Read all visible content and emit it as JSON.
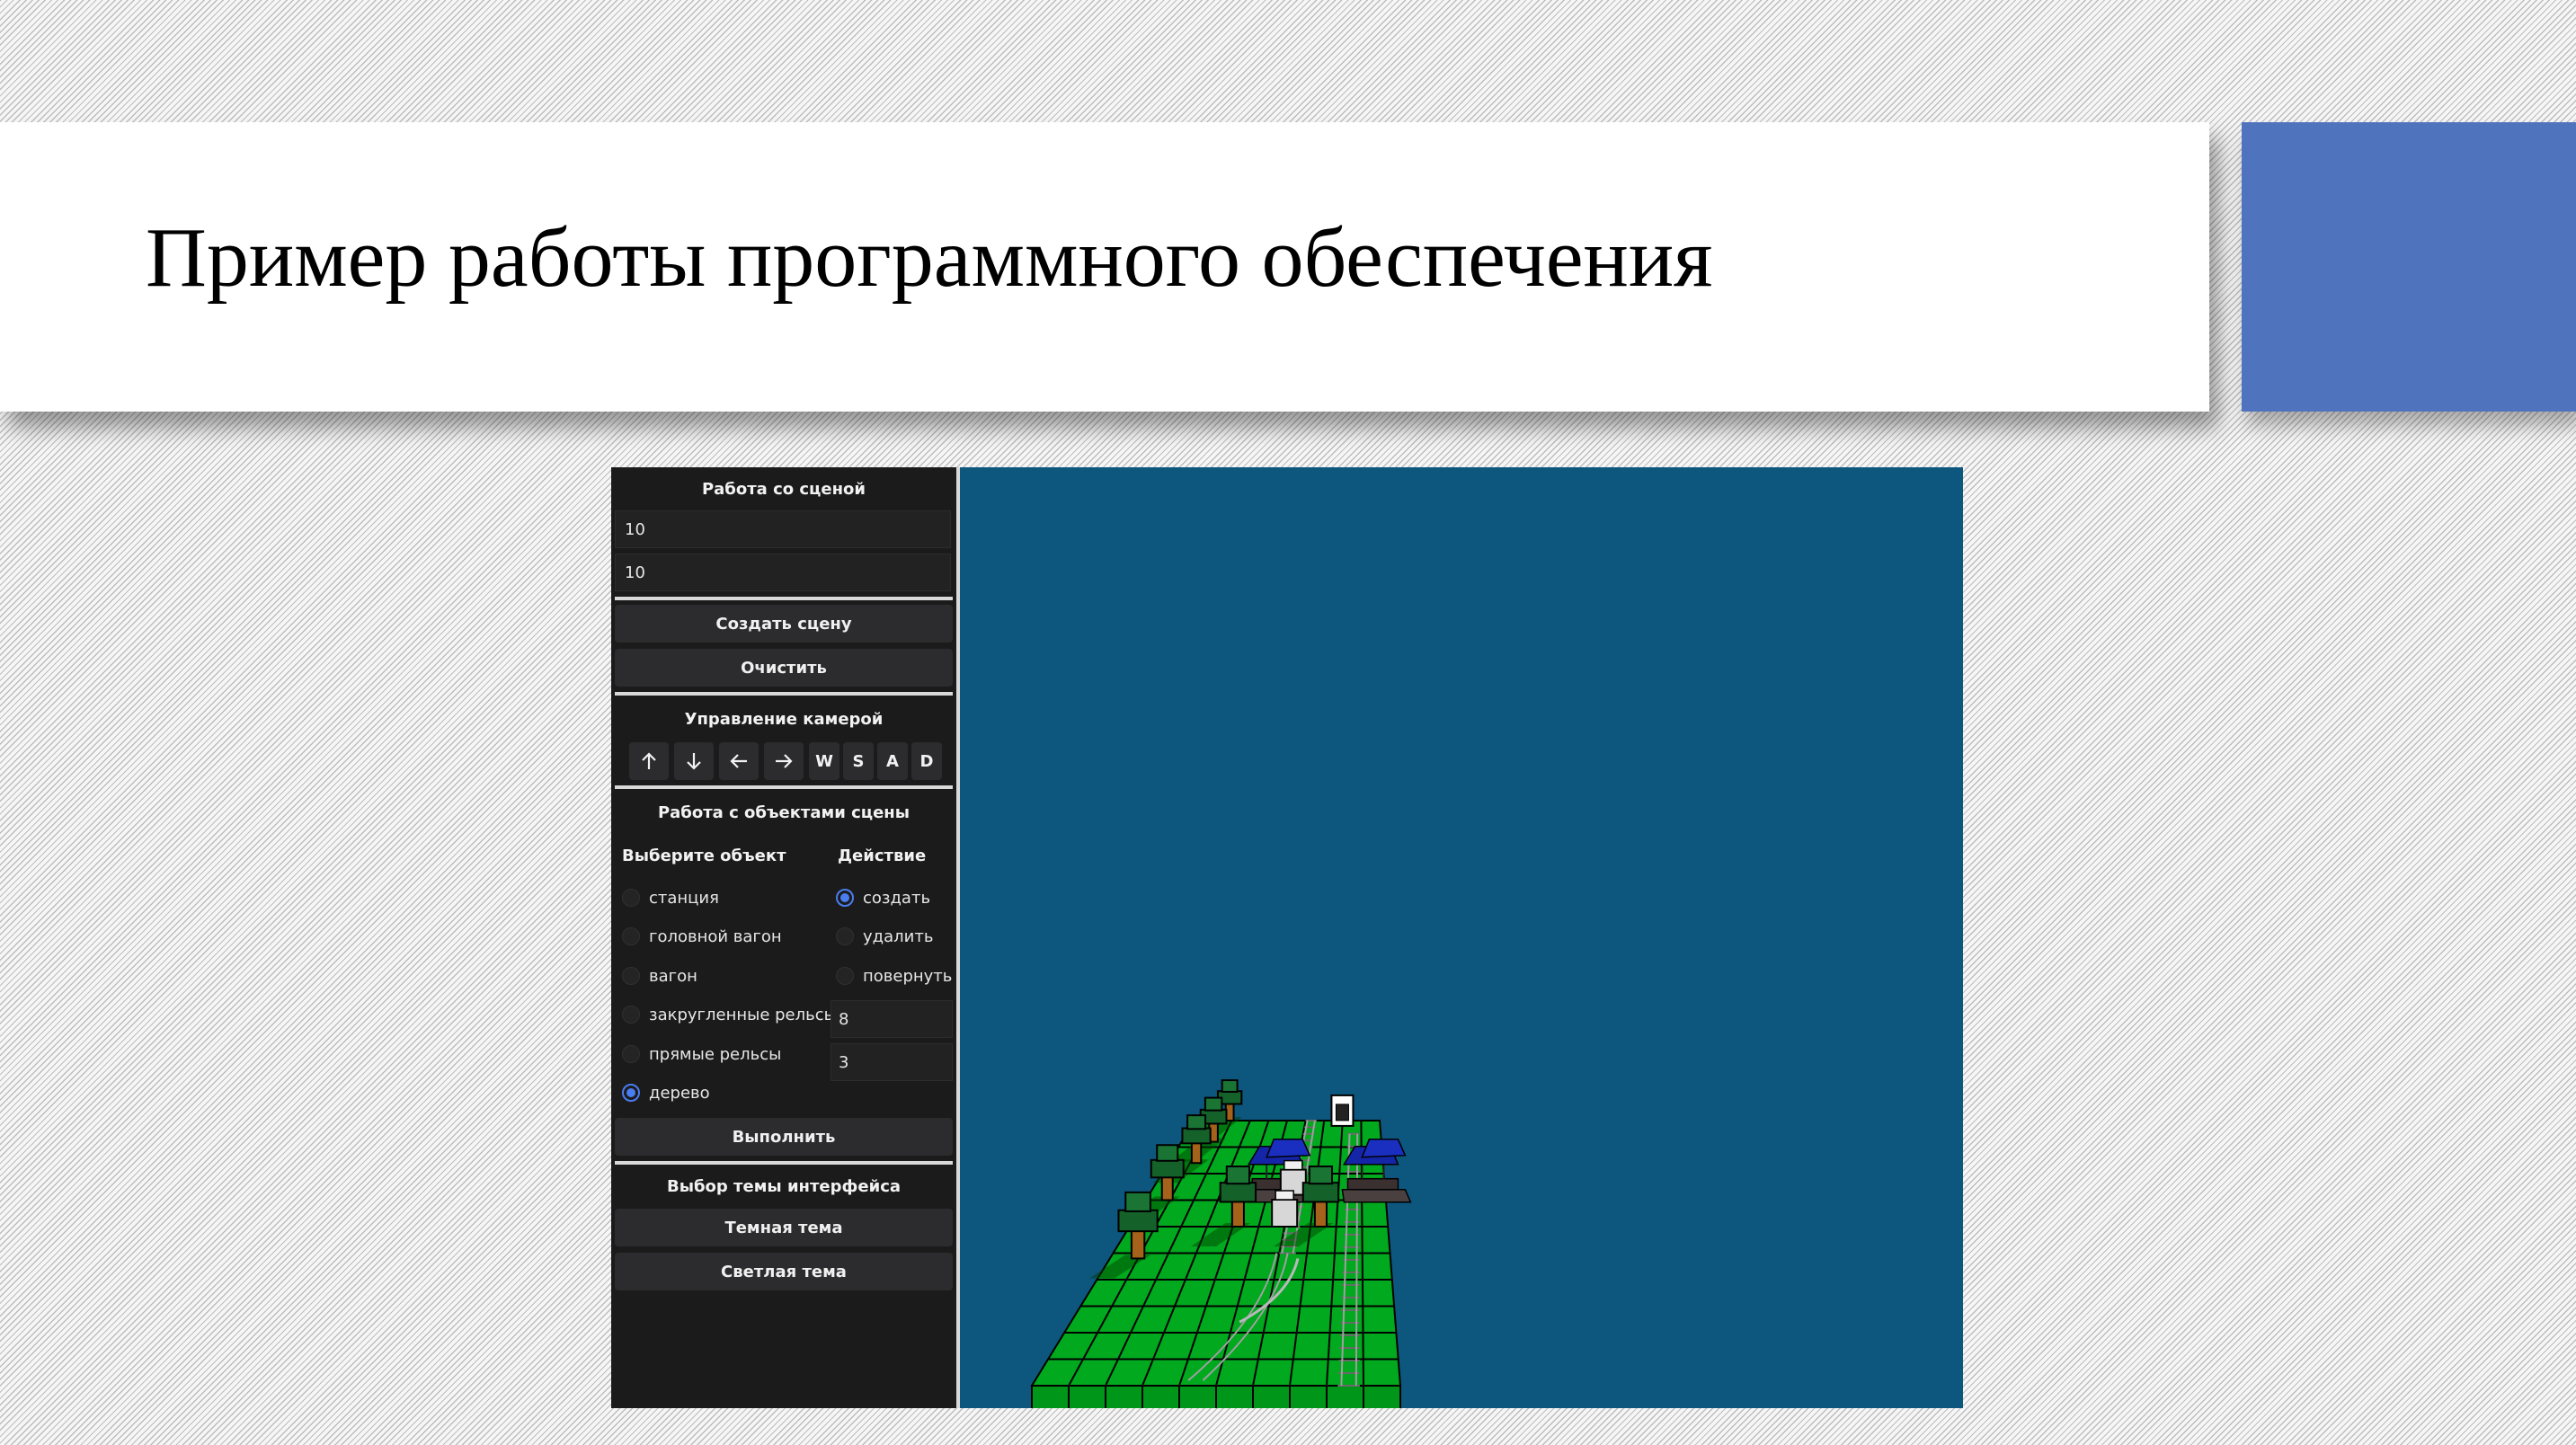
{
  "slide": {
    "title": "Пример работы программного обеспечения"
  },
  "colors": {
    "accent": "#4f73bd",
    "panel_bg": "#1b1b1b",
    "viewport_bg": "#0d577e",
    "grass": "#00a91e",
    "radio_selected": "#4a7df0"
  },
  "panel": {
    "scene": {
      "title": "Работа со сценой",
      "width_value": "10",
      "height_value": "10",
      "create_label": "Создать сцену",
      "clear_label": "Очистить"
    },
    "camera": {
      "title": "Управление камерой",
      "buttons": [
        {
          "label": "↑",
          "icon": "arrow-up-icon"
        },
        {
          "label": "↓",
          "icon": "arrow-down-icon"
        },
        {
          "label": "←",
          "icon": "arrow-left-icon"
        },
        {
          "label": "→",
          "icon": "arrow-right-icon"
        },
        {
          "label": "W"
        },
        {
          "label": "S"
        },
        {
          "label": "A"
        },
        {
          "label": "D"
        }
      ]
    },
    "objects": {
      "title": "Работа с объектами сцены",
      "object_header": "Выберите объект",
      "action_header": "Действие",
      "object_options": [
        {
          "label": "станция",
          "checked": false
        },
        {
          "label": "головной вагон",
          "checked": false
        },
        {
          "label": "вагон",
          "checked": false
        },
        {
          "label": "закругленные рельсы",
          "checked": false
        },
        {
          "label": "прямые рельсы",
          "checked": false
        },
        {
          "label": "дерево",
          "checked": true
        }
      ],
      "action_options": [
        {
          "label": "создать",
          "checked": true
        },
        {
          "label": "удалить",
          "checked": false
        },
        {
          "label": "повернуть",
          "checked": false
        }
      ],
      "param1_value": "8",
      "param2_value": "3",
      "execute_label": "Выполнить"
    },
    "theme": {
      "title": "Выбор темы интерфейса",
      "dark_label": "Темная тема",
      "light_label": "Светлая тема"
    }
  },
  "scene_view": {
    "grid_columns": 10,
    "grid_rows": 10
  }
}
